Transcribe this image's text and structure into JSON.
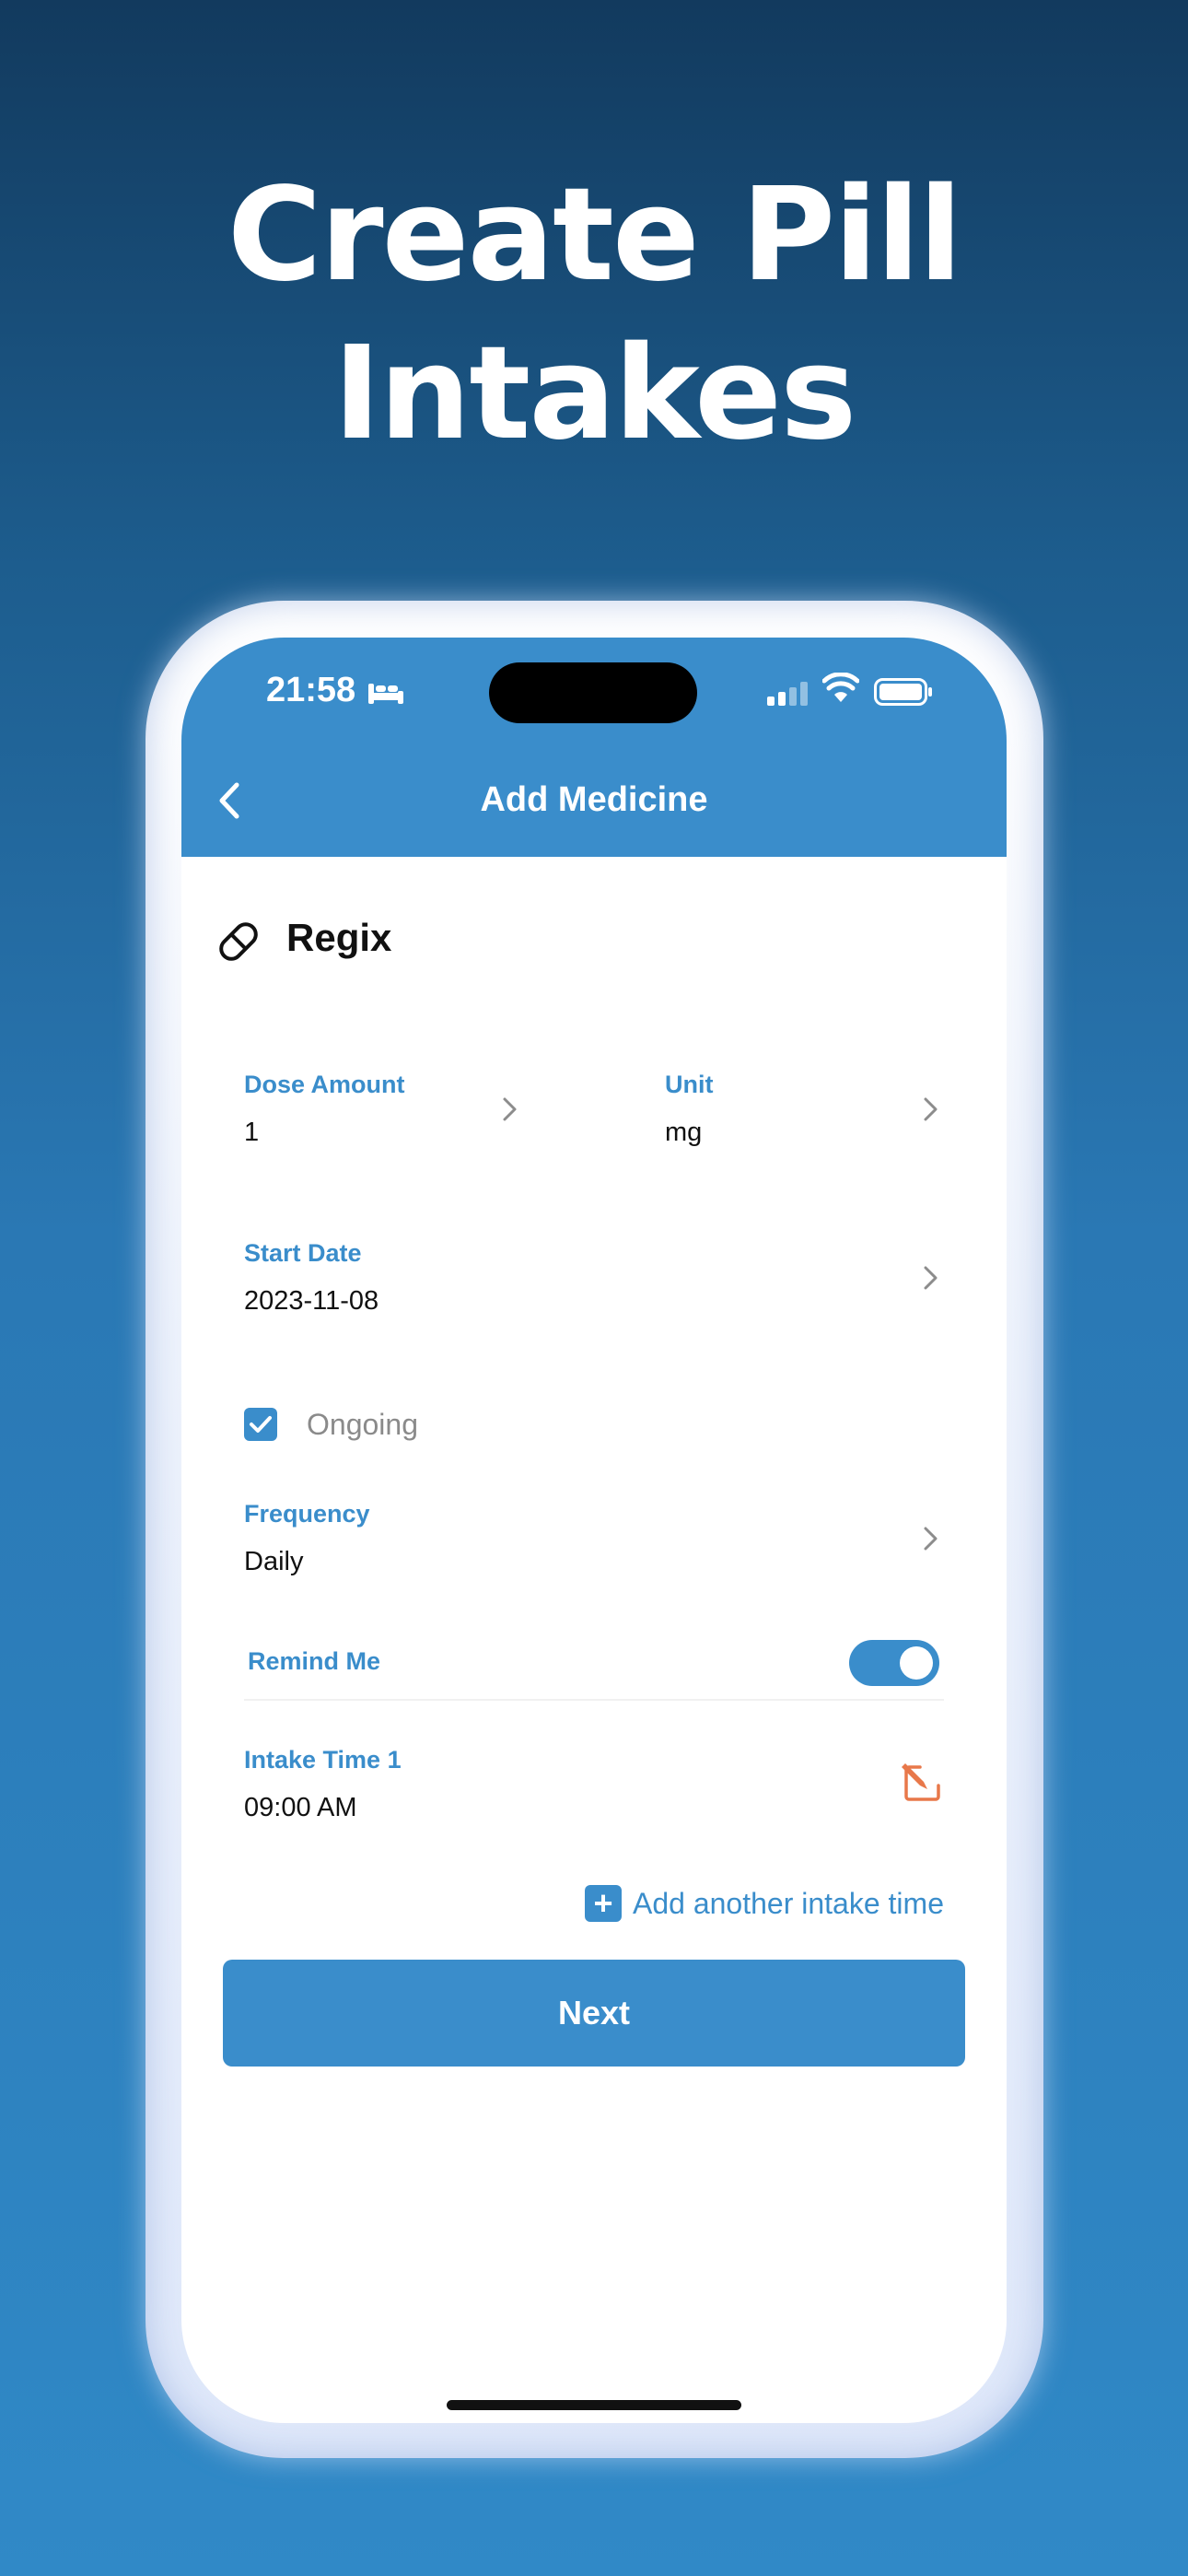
{
  "headline": {
    "line1": "Create Pill",
    "line2": "Intakes"
  },
  "status_bar": {
    "time": "21:58"
  },
  "nav": {
    "title": "Add Medicine"
  },
  "medicine": {
    "name": "Regix"
  },
  "fields": {
    "dose_amount": {
      "label": "Dose Amount",
      "value": "1"
    },
    "unit": {
      "label": "Unit",
      "value": "mg"
    },
    "start_date": {
      "label": "Start Date",
      "value": "2023-11-08"
    },
    "frequency": {
      "label": "Frequency",
      "value": "Daily"
    },
    "intake_time_1": {
      "label": "Intake Time 1",
      "value": "09:00 AM"
    }
  },
  "ongoing": {
    "label": "Ongoing",
    "checked": true
  },
  "remind": {
    "label": "Remind Me",
    "enabled": true
  },
  "add_another": {
    "label": "Add another intake time"
  },
  "next_button": {
    "label": "Next"
  },
  "colors": {
    "accent": "#3a8dcb",
    "edit_icon": "#e8784a",
    "background_top": "#123a5e",
    "background_bottom": "#3089c7"
  },
  "icons": {
    "back": "chevron-left-icon",
    "pill": "pill-icon",
    "chevron": "chevron-right-icon",
    "check": "check-icon",
    "edit": "edit-icon",
    "plus": "plus-icon",
    "bed": "bed-icon",
    "signal": "signal-icon",
    "wifi": "wifi-icon",
    "battery": "battery-icon"
  }
}
